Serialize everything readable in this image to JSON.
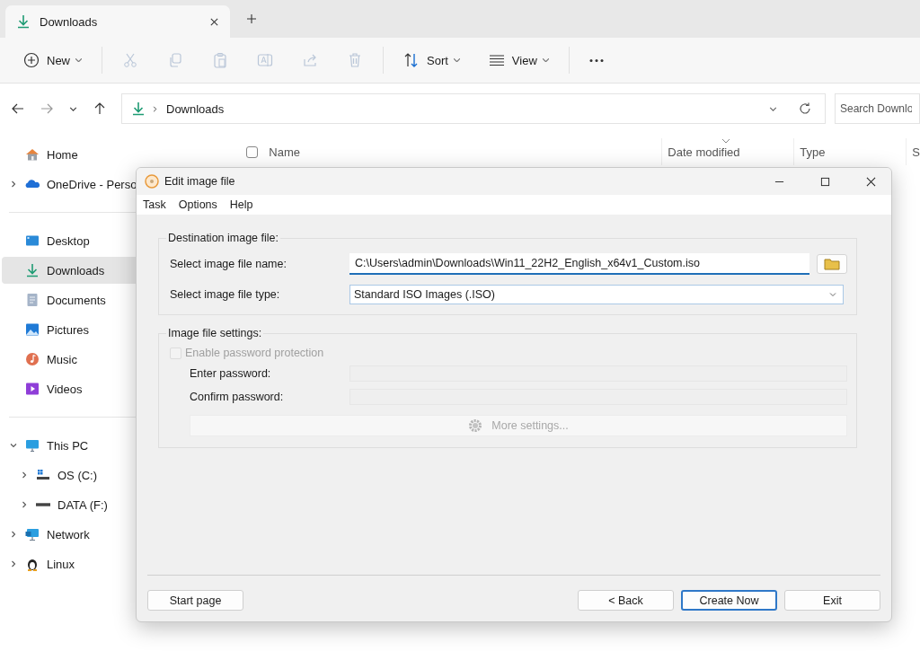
{
  "tab": {
    "title": "Downloads"
  },
  "toolbar": {
    "items": [
      {
        "kind": "new",
        "label": "New"
      },
      {
        "kind": "cut",
        "disabled": true
      },
      {
        "kind": "copy",
        "disabled": true
      },
      {
        "kind": "paste",
        "disabled": true
      },
      {
        "kind": "rename",
        "disabled": true
      },
      {
        "kind": "share",
        "disabled": true
      },
      {
        "kind": "delete",
        "disabled": true
      },
      {
        "kind": "sort",
        "label": "Sort"
      },
      {
        "kind": "view",
        "label": "View"
      },
      {
        "kind": "more"
      }
    ]
  },
  "address_bar": {
    "path": "Downloads"
  },
  "search": {
    "placeholder": "Search Downlo"
  },
  "sidebar": {
    "sections": [
      [
        {
          "label": "Home",
          "selected": false
        },
        {
          "label": "OneDrive - Perso",
          "selected": false,
          "expanded": false
        }
      ],
      [
        {
          "label": "Desktop",
          "selected": false
        },
        {
          "label": "Downloads",
          "selected": true
        },
        {
          "label": "Documents",
          "selected": false
        },
        {
          "label": "Pictures",
          "selected": false
        },
        {
          "label": "Music",
          "selected": false
        },
        {
          "label": "Videos",
          "selected": false
        }
      ],
      [
        {
          "label": "This PC",
          "selected": false,
          "expanded": true,
          "children": [
            {
              "label": "OS (C:)",
              "selected": false,
              "expanded": false
            },
            {
              "label": "DATA (F:)",
              "selected": false,
              "expanded": false
            }
          ]
        },
        {
          "label": "Network",
          "selected": false,
          "expanded": false
        },
        {
          "label": "Linux",
          "selected": false,
          "expanded": false
        }
      ]
    ]
  },
  "file_list": {
    "select_all": {
      "checked": false
    },
    "columns": [
      {
        "label": "Name"
      },
      {
        "label": "Date modified",
        "sorted": true
      },
      {
        "label": "Type"
      },
      {
        "label": "S"
      }
    ]
  },
  "dialog": {
    "title": "Edit image file",
    "menu": [
      "Task",
      "Options",
      "Help"
    ],
    "destination": {
      "title": "Destination image file:",
      "name_label": "Select image file name:",
      "name_value": "C:\\Users\\admin\\Downloads\\Win11_22H2_English_x64v1_Custom.iso",
      "type_label": "Select image file type:",
      "type_value": "Standard ISO Images (.ISO)"
    },
    "settings": {
      "title": "Image file settings:",
      "password_checkbox": {
        "label": "Enable password protection",
        "checked": false,
        "disabled": true
      },
      "enter_label": "Enter password:",
      "confirm_label": "Confirm password:",
      "more_button": {
        "label": "More settings...",
        "disabled": true
      }
    },
    "buttons": [
      {
        "label": "Start page",
        "default": false
      },
      {
        "label": "< Back",
        "default": false
      },
      {
        "label": "Create Now",
        "default": true
      },
      {
        "label": "Exit",
        "default": false
      }
    ]
  }
}
